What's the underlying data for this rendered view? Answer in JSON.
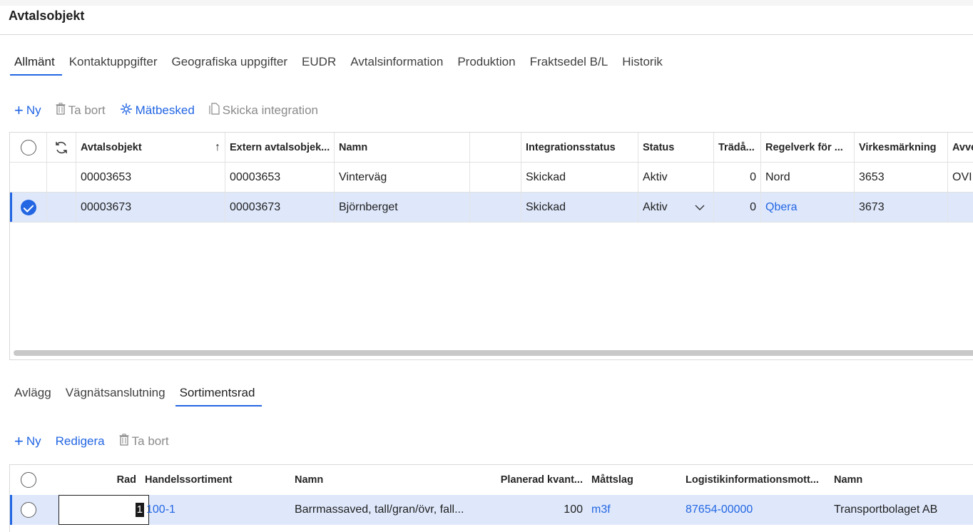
{
  "page": {
    "title": "Avtalsobjekt"
  },
  "main_tabs": [
    "Allmänt",
    "Kontaktuppgifter",
    "Geografiska uppgifter",
    "EUDR",
    "Avtalsinformation",
    "Produktion",
    "Fraktsedel B/L",
    "Historik"
  ],
  "toolbar": {
    "new": "Ny",
    "delete": "Ta bort",
    "measure": "Mätbesked",
    "send": "Skicka integration"
  },
  "grid": {
    "headers": [
      "Avtalsobjekt",
      "Extern avtalsobjek...",
      "Namn",
      "",
      "Integrationsstatus",
      "Status",
      "Trädå...",
      "Regelverk för ...",
      "Virkesmärkning",
      "Avve"
    ],
    "rows": [
      {
        "id": "00003653",
        "ext": "00003653",
        "name": "Vinterväg",
        "integ": "Skickad",
        "status": "Aktiv",
        "trad": "0",
        "regel": "Nord",
        "virke": "3653",
        "avve": "OVI"
      },
      {
        "id": "00003673",
        "ext": "00003673",
        "name": "Björnberget",
        "integ": "Skickad",
        "status": "Aktiv",
        "trad": "0",
        "regel": "Qbera",
        "virke": "3673",
        "avve": ""
      }
    ]
  },
  "sub_tabs": [
    "Avlägg",
    "Vägnätsanslutning",
    "Sortimentsrad"
  ],
  "sub_toolbar": {
    "new": "Ny",
    "edit": "Redigera",
    "delete": "Ta bort"
  },
  "sub_grid": {
    "headers": [
      "Rad",
      "Handelssortiment",
      "Namn",
      "Planerad kvant...",
      "Måttslag",
      "Logistikinformationsmott...",
      "Namn"
    ],
    "rows": [
      {
        "rad": "1",
        "sortiment": "100-1",
        "name": "Barrmassaved, tall/gran/övr, fall...",
        "qty": "100",
        "unit": "m3f",
        "logistics": "87654-00000",
        "lname": "Transportbolaget AB"
      }
    ]
  },
  "colors": {
    "accent": "#2266e3",
    "selected_row": "#dfe8fb"
  }
}
